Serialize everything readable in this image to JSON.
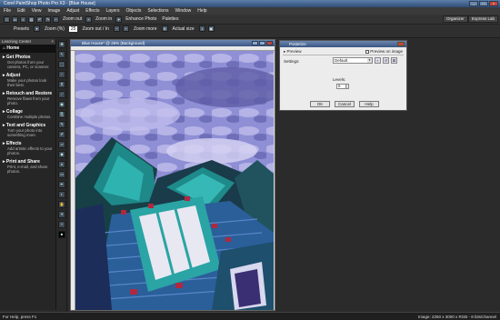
{
  "app": {
    "title": "Corel PaintShop Photo Pro X3 - [Blue House]",
    "window_controls": [
      "_",
      "□",
      "×"
    ]
  },
  "menu": [
    "File",
    "Edit",
    "View",
    "Image",
    "Adjust",
    "Effects",
    "Layers",
    "Objects",
    "Selections",
    "Window",
    "Help"
  ],
  "toolbar": {
    "zoom_out": "Zoom out",
    "zoom_in": "Zoom in",
    "enhance": "Enhance Photo",
    "palettes": "Palettes",
    "organizer": "Organizer",
    "express_lab": "Express Lab"
  },
  "toolbar2": {
    "presets": "Presets",
    "zoom": "Zoom (%)",
    "zoom_value": "25",
    "zoom_more": "Zoom out / In",
    "zoom_more2": "Zoom more",
    "actual": "Actual size"
  },
  "learning": {
    "title": "Learning Center",
    "home": "Home",
    "sections": [
      {
        "h": "Get Photos",
        "d": "Get photos from your camera, PC, or scanner."
      },
      {
        "h": "Adjust",
        "d": "Make your photos look their best."
      },
      {
        "h": "Retouch and Restore",
        "d": "Remove flaws from your photo."
      },
      {
        "h": "Collage",
        "d": "Combine multiple photos."
      },
      {
        "h": "Text and Graphics",
        "d": "Turn your photo into something more."
      },
      {
        "h": "Effects",
        "d": "Add artistic effects to your photos."
      },
      {
        "h": "Print and Share",
        "d": "Print, e-mail, and share photos."
      }
    ]
  },
  "canvas": {
    "title": "Blue House* @ 25% (Background)"
  },
  "dialog": {
    "title": "Posterize",
    "preview": "Preview",
    "preview_on_image": "Preview on image",
    "settings_label": "Settings:",
    "settings_value": "Default",
    "levels_label": "Levels:",
    "levels_value": "6",
    "ok": "OK",
    "cancel": "Cancel",
    "help": "Help"
  },
  "status": {
    "left": "For Help, press F1",
    "right": "Image: 2250 x 3000 x RGB - 8 bits/channel"
  },
  "colors": {
    "accent": "#3a5683",
    "sky": "#9a97d8",
    "teal": "#1e8e8e"
  }
}
